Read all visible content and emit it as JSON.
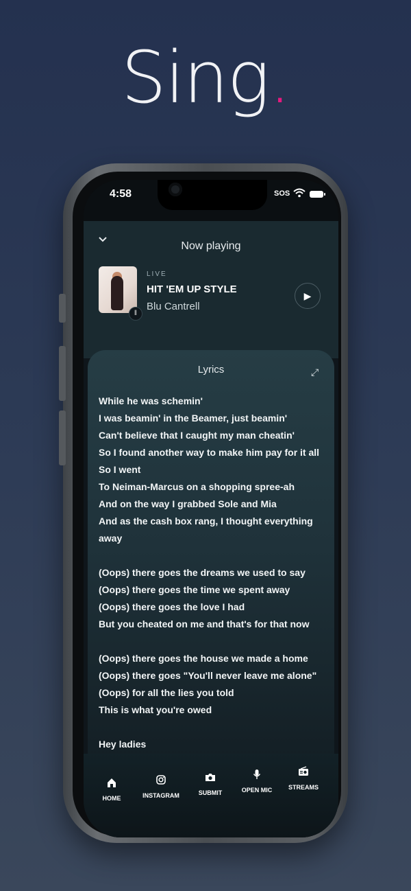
{
  "brand": {
    "name": "Sing",
    "dot": ".",
    "dot_color": "#e6197e"
  },
  "status_bar": {
    "time": "4:58",
    "sos": "SOS"
  },
  "now_playing": {
    "title": "Now playing",
    "badge": "LIVE",
    "song": "HIT 'EM UP STYLE",
    "artist": "Blu Cantrell",
    "icons": {
      "collapse": "chevron-down-icon",
      "play": "play-icon",
      "wave": "sound-wave-icon"
    }
  },
  "lyrics": {
    "title": "Lyrics",
    "lines": [
      "While he was schemin'",
      "I was beamin' in the Beamer, just beamin'",
      "Can't believe that I caught my man cheatin'",
      "So I found another way to make him pay for it all",
      "So I went",
      "To Neiman-Marcus on a shopping spree-ah",
      "And on the way I grabbed Sole and Mia",
      "And as the cash box rang, I thought everything",
      "away",
      "",
      "(Oops) there goes the dreams we used to say",
      "(Oops) there goes the time we spent away",
      "(Oops) there goes the love I had",
      "But you cheated on me and that's for that now",
      "",
      "(Oops) there goes the house we made a home",
      "(Oops) there goes \"You'll never leave me alone\"",
      "(Oops) for all the lies you told",
      "This is what you're owed",
      "",
      "Hey ladies"
    ]
  },
  "tabs": [
    {
      "label": "HOME",
      "icon": "home-icon"
    },
    {
      "label": "INSTAGRAM",
      "icon": "instagram-icon"
    },
    {
      "label": "SUBMIT",
      "icon": "camera-icon"
    },
    {
      "label": "OPEN MIC",
      "icon": "microphone-icon"
    },
    {
      "label": "STREAMS",
      "icon": "radio-icon"
    }
  ]
}
